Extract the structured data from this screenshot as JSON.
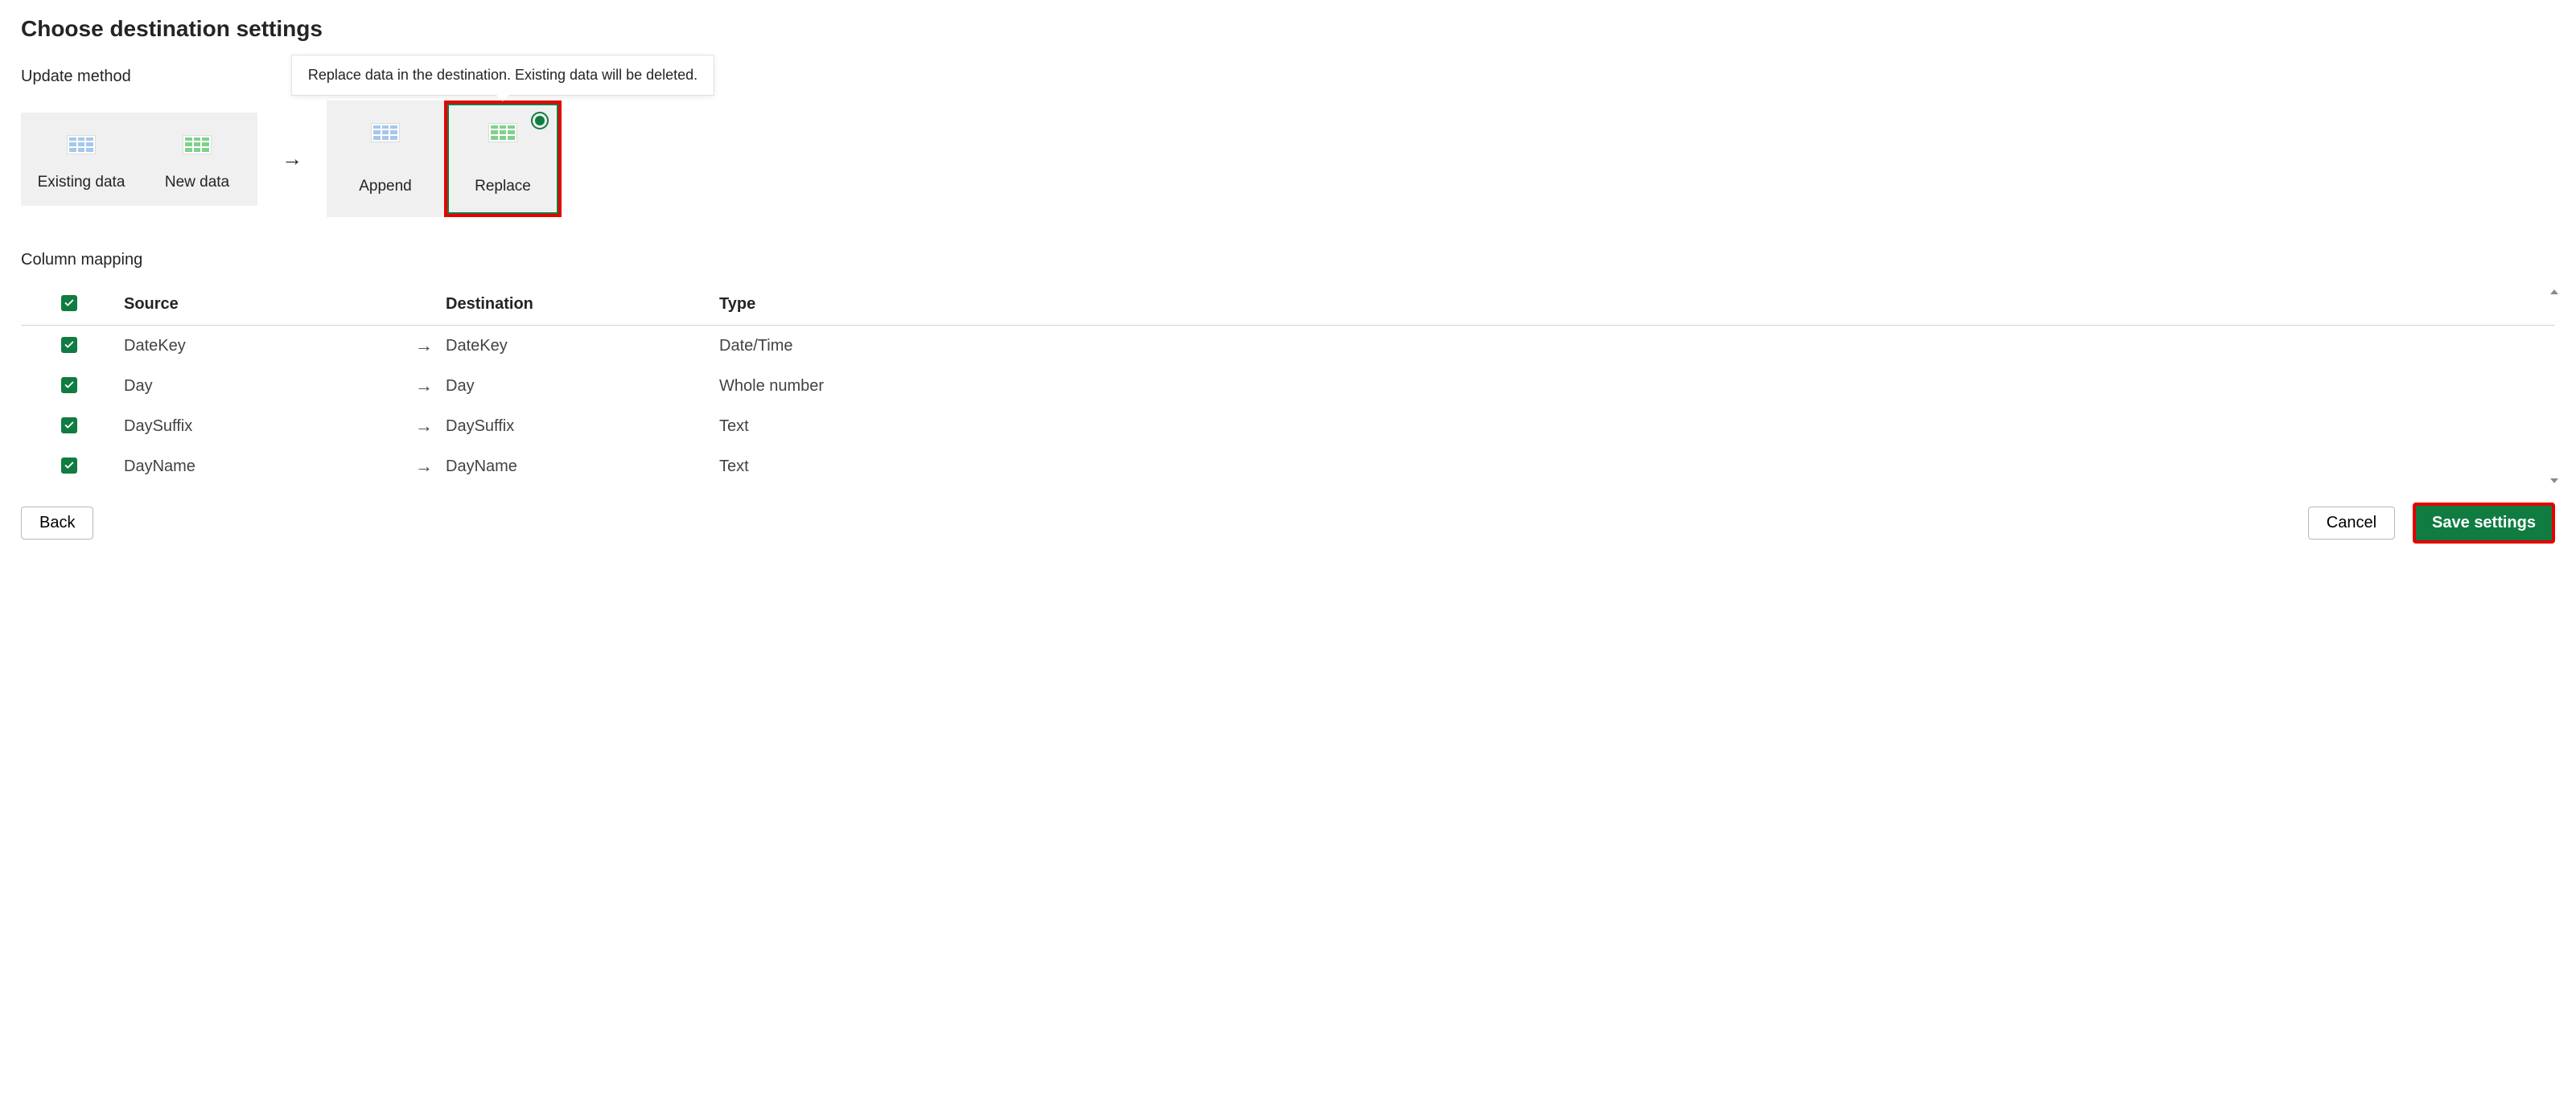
{
  "title": "Choose destination settings",
  "update_method": {
    "label": "Update method",
    "existing_label": "Existing data",
    "new_label": "New data",
    "append_label": "Append",
    "replace_label": "Replace",
    "tooltip": "Replace data in the destination. Existing data will be deleted.",
    "selected": "replace"
  },
  "column_mapping": {
    "label": "Column mapping",
    "headers": {
      "source": "Source",
      "destination": "Destination",
      "type": "Type"
    },
    "rows": [
      {
        "source": "DateKey",
        "destination": "DateKey",
        "type": "Date/Time",
        "checked": true
      },
      {
        "source": "Day",
        "destination": "Day",
        "type": "Whole number",
        "checked": true
      },
      {
        "source": "DaySuffix",
        "destination": "DaySuffix",
        "type": "Text",
        "checked": true
      },
      {
        "source": "DayName",
        "destination": "DayName",
        "type": "Text",
        "checked": true
      }
    ]
  },
  "footer": {
    "back": "Back",
    "cancel": "Cancel",
    "save": "Save settings"
  },
  "arrow_glyph": "→"
}
